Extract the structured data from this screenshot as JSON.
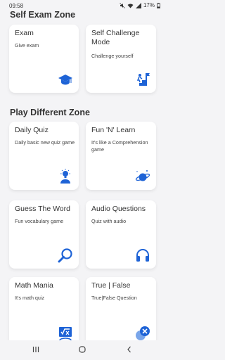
{
  "status_bar": {
    "time": "09:58",
    "battery": "17%"
  },
  "sections": {
    "self_exam": {
      "title": "Self Exam Zone"
    },
    "play": {
      "title": "Play Different Zone"
    }
  },
  "cards": {
    "exam": {
      "title": "Exam",
      "desc": "Give exam",
      "icon": "graduation-cap-icon"
    },
    "self_challenge": {
      "title": "Self Challenge Mode",
      "desc": "Challenge yourself",
      "icon": "climb-stairs-icon"
    },
    "daily_quiz": {
      "title": "Daily Quiz",
      "desc": "Daily basic new quiz game",
      "icon": "lightbulb-person-icon"
    },
    "fun_n_learn": {
      "title": "Fun 'N' Learn",
      "desc": "It's like a Comprehension game",
      "icon": "planet-icon"
    },
    "guess_the_word": {
      "title": "Guess The Word",
      "desc": "Fun vocabulary game",
      "icon": "magnifier-icon"
    },
    "audio_questions": {
      "title": "Audio Questions",
      "desc": "Quiz with audio",
      "icon": "headphones-icon"
    },
    "math_mania": {
      "title": "Math Mania",
      "desc": "It's math quiz",
      "icon": "math-icon"
    },
    "true_false": {
      "title": "True | False",
      "desc": "True|False Question",
      "icon": "check-cross-icon"
    }
  },
  "colors": {
    "accent": "#1e63d6",
    "background": "#f4f4f6",
    "card": "#ffffff"
  }
}
